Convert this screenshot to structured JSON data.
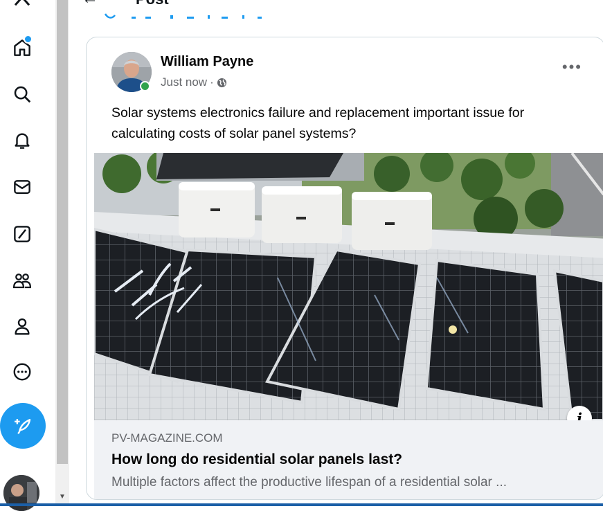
{
  "header": {
    "title": "Post"
  },
  "nav": {
    "items": [
      {
        "name": "home",
        "icon": "home-icon"
      },
      {
        "name": "explore",
        "icon": "search-icon"
      },
      {
        "name": "notifications",
        "icon": "bell-icon"
      },
      {
        "name": "messages",
        "icon": "mail-icon"
      },
      {
        "name": "grok",
        "icon": "grok-icon"
      },
      {
        "name": "communities",
        "icon": "people-icon"
      },
      {
        "name": "profile",
        "icon": "person-icon"
      },
      {
        "name": "more",
        "icon": "more-circle-icon"
      }
    ],
    "compose_icon": "feather-plus-icon",
    "accent_color": "#1d9bf0"
  },
  "post": {
    "author": "William Payne",
    "time": "Just now",
    "separator": "·",
    "privacy_icon": "globe-icon",
    "more_label": "•••",
    "text": "Solar systems electronics failure and replacement important issue for calculating costs of solar panel systems?",
    "image_alt": "Rooftop solar panels with microinverter boxes",
    "info_label": "i",
    "link": {
      "domain": "PV-MAGAZINE.COM",
      "title": "How long do residential solar panels last?",
      "description": "Multiple factors affect the productive lifespan of a residential solar ..."
    }
  }
}
